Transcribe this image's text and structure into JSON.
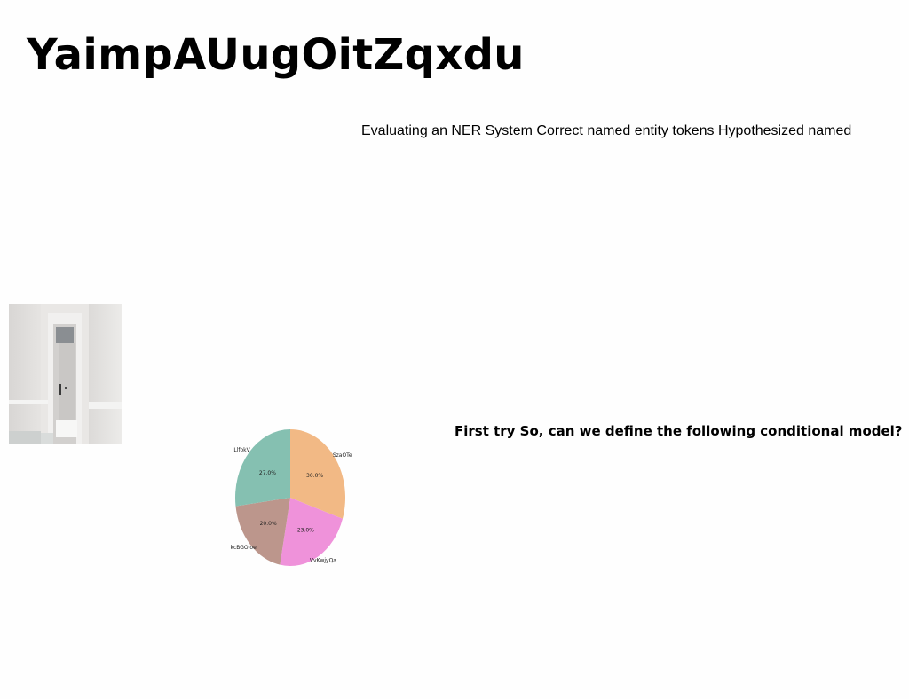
{
  "slide": {
    "title": "YaimpAUugOitZqxdu",
    "text_1": "Evaluating an NER System Correct named entity tokens Hypothesized named",
    "text_2": "First try So, can we define the following conditional model?"
  },
  "image": {
    "icon": "doorway-photo"
  },
  "chart_data": {
    "type": "pie",
    "categories": [
      "SzaOTe",
      "VvKwjyQa",
      "kcBGOIoe",
      "LlfokV"
    ],
    "values": [
      30.0,
      23.0,
      20.0,
      27.0
    ],
    "labels": [
      "30.0%",
      "23.0%",
      "20.0%",
      "27.0%"
    ],
    "colors": [
      "#f2b985",
      "#ef92da",
      "#bc968c",
      "#85c0b1"
    ],
    "start_angle_deg": 90,
    "direction": "clockwise"
  }
}
